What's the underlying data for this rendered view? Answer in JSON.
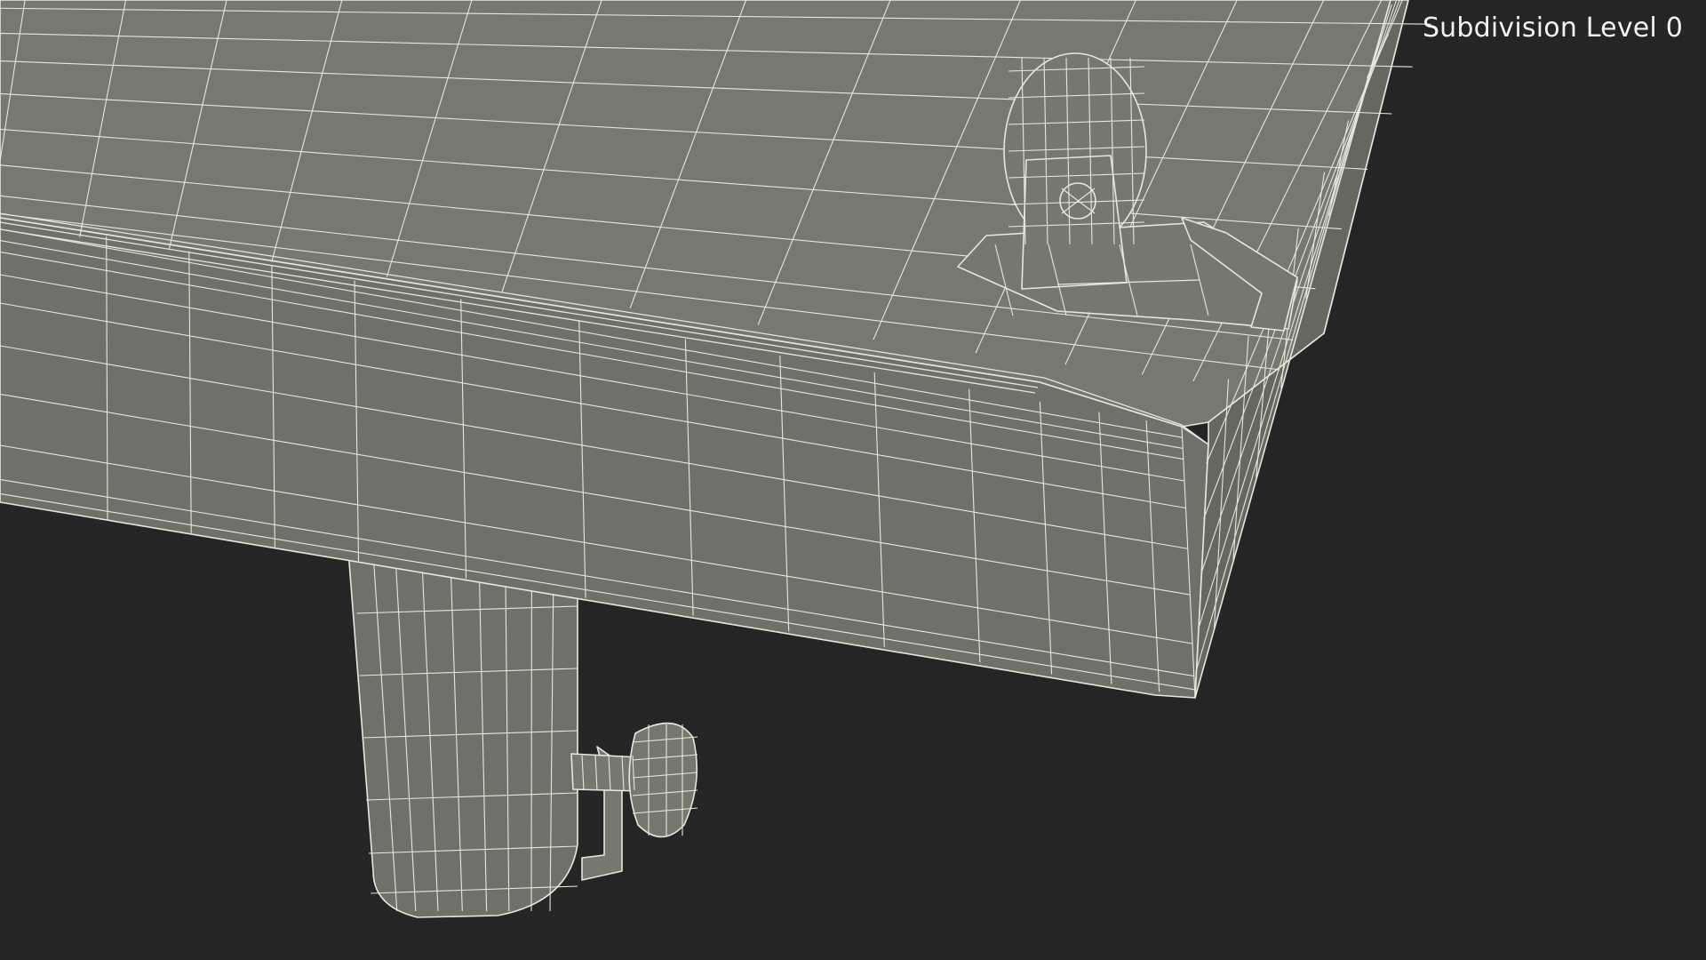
{
  "overlay": {
    "subdivision_label": "Subdivision Level 0"
  },
  "colors": {
    "background": "#252525",
    "surface_top": "#777870",
    "surface_front": "#6f706a",
    "surface_side": "#66675f",
    "wire": "#e8e7dc",
    "leg": "#6f706a",
    "hardware": "#76776f"
  }
}
